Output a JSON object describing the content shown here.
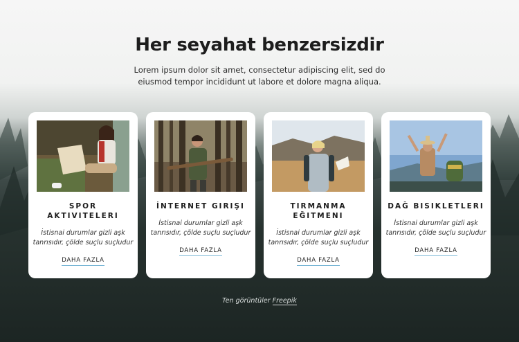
{
  "heading": "Her seyahat benzersizdir",
  "intro": "Lorem ipsum dolor sit amet, consectetur adipiscing elit, sed do eiusmod tempor incididunt ut labore et dolore magna aliqua.",
  "cards": [
    {
      "title": "SPOR AKTIVITELERI",
      "description": "İstisnai durumlar gizli aşk tanrısıdır, çölde suçlu suçludur",
      "link": "DAHA FAZLA",
      "photo_icon": "hiker-with-map-photo"
    },
    {
      "title": "İNTERNET GIRIŞI",
      "description": "İstisnai durumlar gizli aşk tanrısıdır, çölde suçlu suçludur",
      "link": "DAHA FAZLA",
      "photo_icon": "hiker-in-forest-photo"
    },
    {
      "title": "TIRMANMA EĞITMENI",
      "description": "İstisnai durumlar gizli aşk tanrısıdır, çölde suçlu suçludur",
      "link": "DAHA FAZLA",
      "photo_icon": "hiker-on-hill-photo"
    },
    {
      "title": "DAĞ BISIKLETLERI",
      "description": "İstisnai durumlar gizli aşk tanrısıdır, çölde suçlu suçludur",
      "link": "DAHA FAZLA",
      "photo_icon": "hiker-arms-raised-photo"
    }
  ],
  "credit": {
    "prefix": "Ten görüntüler",
    "link": "Freepik"
  },
  "colors": {
    "card_bg": "#ffffff",
    "link_underline": "#7ab7d6",
    "forest_dark": "#1c2523"
  }
}
